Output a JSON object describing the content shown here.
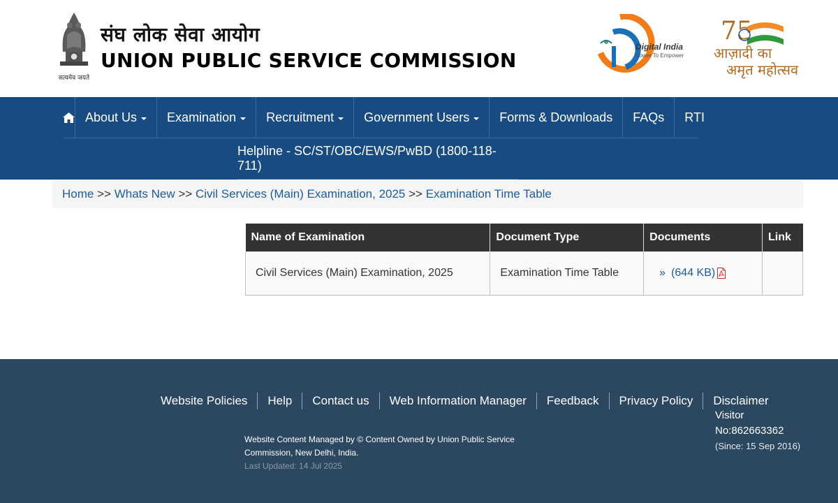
{
  "header": {
    "emblem_motto": "सत्यमेव जयते",
    "title_hindi": "संघ लोक सेवा आयोग",
    "title_english": "UNION PUBLIC SERVICE COMMISSION",
    "digital_india": {
      "title": "Digital India",
      "tagline": "Power To Empower"
    },
    "azadi": {
      "line1": "आज़ादी का",
      "line2": "अमृत महोत्सव",
      "number": "75"
    }
  },
  "nav": {
    "items": [
      {
        "label": "About Us",
        "dropdown": true
      },
      {
        "label": "Examination",
        "dropdown": true
      },
      {
        "label": "Recruitment",
        "dropdown": true
      },
      {
        "label": "Government Users",
        "dropdown": true
      },
      {
        "label": "Forms & Downloads",
        "dropdown": false
      },
      {
        "label": "FAQs",
        "dropdown": false
      },
      {
        "label": "RTI",
        "dropdown": false
      }
    ],
    "helpline": "Helpline - SC/ST/OBC/EWS/PwBD (1800-118-711)"
  },
  "breadcrumb": {
    "items": [
      "Home",
      "Whats New",
      "Civil Services (Main) Examination, 2025",
      "Examination Time Table"
    ],
    "separator": ">>"
  },
  "table": {
    "headers": [
      "Name of Examination",
      "Document Type",
      "Documents",
      "Link"
    ],
    "rows": [
      {
        "exam": "Civil Services (Main) Examination, 2025",
        "doc_type": "Examination Time Table",
        "doc_bullet": "»",
        "doc_label": "(644 KB)",
        "link": ""
      }
    ]
  },
  "footer": {
    "links": [
      "Website Policies",
      "Help",
      "Contact us",
      "Web Information Manager",
      "Feedback",
      "Privacy Policy",
      "Disclaimer"
    ],
    "info": "Website Content Managed by © Content Owned by Union Public Service Commission, New Delhi, India.",
    "last_updated": "Last Updated: 14 Jul 2025",
    "visitor_label": "Visitor",
    "visitor_number": "No:862663362",
    "visitor_since": "(Since: 15 Sep 2016)"
  },
  "colors": {
    "nav_bg": "#174b82",
    "footer_bg": "#2c4760",
    "link": "#1d5c9b",
    "table_header": "#333333"
  }
}
